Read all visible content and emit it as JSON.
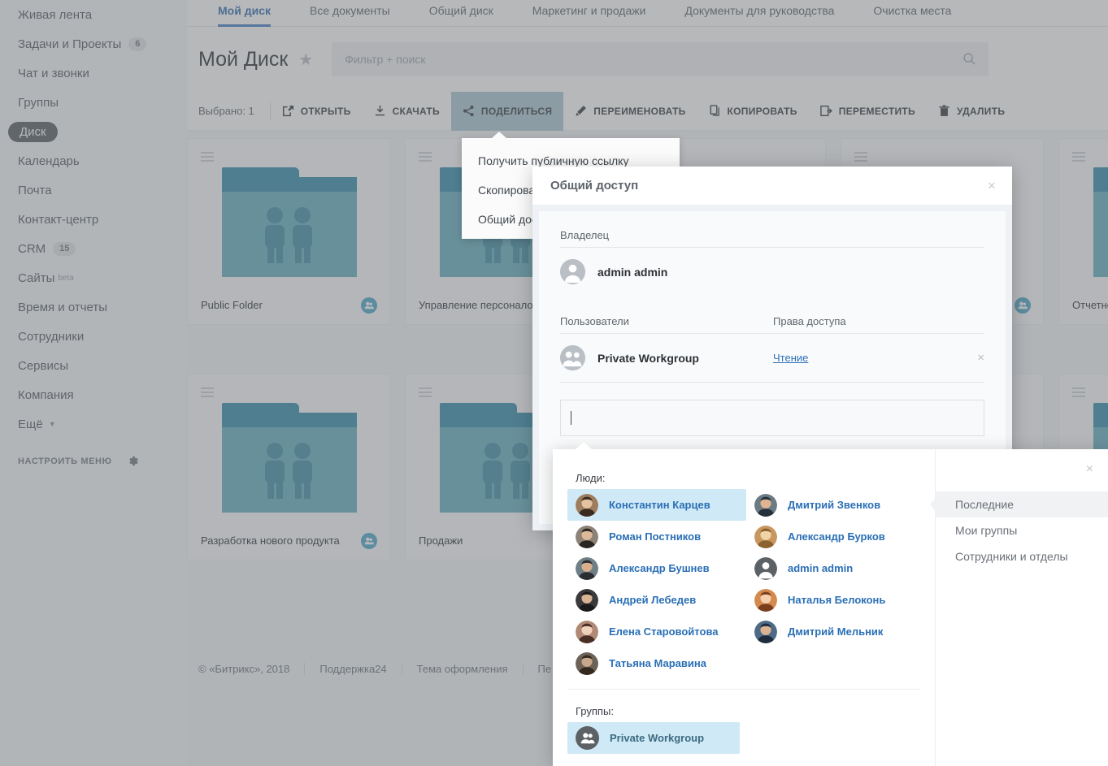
{
  "sidebar": {
    "items": [
      {
        "label": "Живая лента",
        "badge": null,
        "active": false
      },
      {
        "label": "Задачи и Проекты",
        "badge": "6",
        "active": false
      },
      {
        "label": "Чат и звонки",
        "badge": null,
        "active": false
      },
      {
        "label": "Группы",
        "badge": null,
        "active": false
      },
      {
        "label": "Диск",
        "badge": null,
        "active": true
      },
      {
        "label": "Календарь",
        "badge": null,
        "active": false
      },
      {
        "label": "Почта",
        "badge": null,
        "active": false
      },
      {
        "label": "Контакт-центр",
        "badge": null,
        "active": false
      },
      {
        "label": "CRM",
        "badge": "15",
        "active": false
      },
      {
        "label": "Сайты",
        "badge": null,
        "beta": "beta",
        "active": false
      },
      {
        "label": "Время и отчеты",
        "badge": null,
        "active": false
      },
      {
        "label": "Сотрудники",
        "badge": null,
        "active": false
      },
      {
        "label": "Сервисы",
        "badge": null,
        "active": false
      },
      {
        "label": "Компания",
        "badge": null,
        "active": false
      },
      {
        "label": "Ещё",
        "badge": null,
        "caret": true,
        "active": false
      }
    ],
    "configure_label": "НАСТРОИТЬ МЕНЮ"
  },
  "tabs": [
    {
      "label": "Мой диск",
      "active": true
    },
    {
      "label": "Все документы",
      "active": false
    },
    {
      "label": "Общий диск",
      "active": false
    },
    {
      "label": "Маркетинг и продажи",
      "active": false
    },
    {
      "label": "Документы для руководства",
      "active": false
    },
    {
      "label": "Очистка места",
      "active": false
    }
  ],
  "header": {
    "title": "Мой Диск",
    "star": "★",
    "search_placeholder": "Фильтр + поиск"
  },
  "toolbar": {
    "selected_label": "Выбрано: 1",
    "buttons": [
      {
        "label": "ОТКРЫТЬ",
        "icon": "open-icon",
        "active": false
      },
      {
        "label": "СКАЧАТЬ",
        "icon": "download-icon",
        "active": false
      },
      {
        "label": "ПОДЕЛИТЬСЯ",
        "icon": "share-icon",
        "active": true
      },
      {
        "label": "ПЕРЕИМЕНОВАТЬ",
        "icon": "pencil-icon",
        "active": false
      },
      {
        "label": "КОПИРОВАТЬ",
        "icon": "copy-icon",
        "active": false
      },
      {
        "label": "ПЕРЕМЕСТИТЬ",
        "icon": "move-icon",
        "active": false
      },
      {
        "label": "УДАЛИТЬ",
        "icon": "trash-icon",
        "active": false
      }
    ]
  },
  "share_menu": {
    "items": [
      {
        "label": "Получить публичную ссылку"
      },
      {
        "label": "Скопировать ссылку"
      },
      {
        "label": "Общий доступ"
      }
    ]
  },
  "folders": [
    {
      "name": "Public Folder",
      "shared": true,
      "row": 0,
      "col": 0
    },
    {
      "name": "Управление персоналом",
      "shared": true,
      "row": 0,
      "col": 1
    },
    {
      "name": "",
      "shared": false,
      "row": 0,
      "col": 2
    },
    {
      "name": "",
      "shared": true,
      "row": 0,
      "col": 3
    },
    {
      "name": "Отчетность",
      "shared": false,
      "row": 0,
      "col": 4
    },
    {
      "name": "Разработка нового продукта",
      "shared": true,
      "row": 1,
      "col": 0
    },
    {
      "name": "Продажи",
      "shared": false,
      "row": 1,
      "col": 1
    },
    {
      "name": "",
      "shared": false,
      "row": 1,
      "col": 2
    },
    {
      "name": "",
      "shared": false,
      "row": 1,
      "col": 3
    },
    {
      "name": "",
      "shared": false,
      "row": 1,
      "col": 4
    }
  ],
  "footer": {
    "links": [
      "© «Битрикс», 2018",
      "Поддержка24",
      "Тема оформления",
      "Пе"
    ]
  },
  "dialog": {
    "title": "Общий доступ",
    "close": "×",
    "owner_label": "Владелец",
    "owner_name": "admin admin",
    "users_label": "Пользователи",
    "rights_label": "Права доступа",
    "rows": [
      {
        "name": "Private Workgroup",
        "permission": "Чтение",
        "remove": "×"
      }
    ],
    "input_value": ""
  },
  "picker": {
    "close": "×",
    "people_label": "Люди:",
    "groups_label": "Группы:",
    "people_col1": [
      {
        "name": "Константин Карцев",
        "selected": true,
        "avatar": "photo-kartsev"
      },
      {
        "name": "Роман Постников",
        "selected": false,
        "avatar": "photo-postnikov"
      },
      {
        "name": "Александр Бушнев",
        "selected": false,
        "avatar": "photo-bushnev"
      },
      {
        "name": "Андрей Лебедев",
        "selected": false,
        "avatar": "photo-lebedev"
      },
      {
        "name": "Елена Старовойтова",
        "selected": false,
        "avatar": "photo-starovoytova"
      },
      {
        "name": "Татьяна Маравина",
        "selected": false,
        "avatar": "photo-maravina"
      }
    ],
    "people_col2": [
      {
        "name": "Дмитрий Звенков",
        "selected": false,
        "avatar": "photo-zvenkov"
      },
      {
        "name": "Александр Бурков",
        "selected": false,
        "avatar": "photo-burkov"
      },
      {
        "name": "admin admin",
        "selected": false,
        "avatar": "default-user-icon"
      },
      {
        "name": "Наталья Белоконь",
        "selected": false,
        "avatar": "photo-belokon"
      },
      {
        "name": "Дмитрий Мельник",
        "selected": false,
        "avatar": "photo-melnik"
      }
    ],
    "groups": [
      {
        "name": "Private Workgroup",
        "selected": true
      }
    ],
    "side_tabs": [
      {
        "label": "Последние",
        "selected": true
      },
      {
        "label": "Мои группы",
        "selected": false
      },
      {
        "label": "Сотрудники и отделы",
        "selected": false
      }
    ]
  },
  "colors": {
    "accent": "#2a6fb5",
    "tab_active": "#3f7dc4",
    "folder_body": "#62aec1",
    "folder_tab": "#2f8aa8",
    "selection": "#cfe9f6",
    "toolbar_active": "#a9c7d4"
  }
}
